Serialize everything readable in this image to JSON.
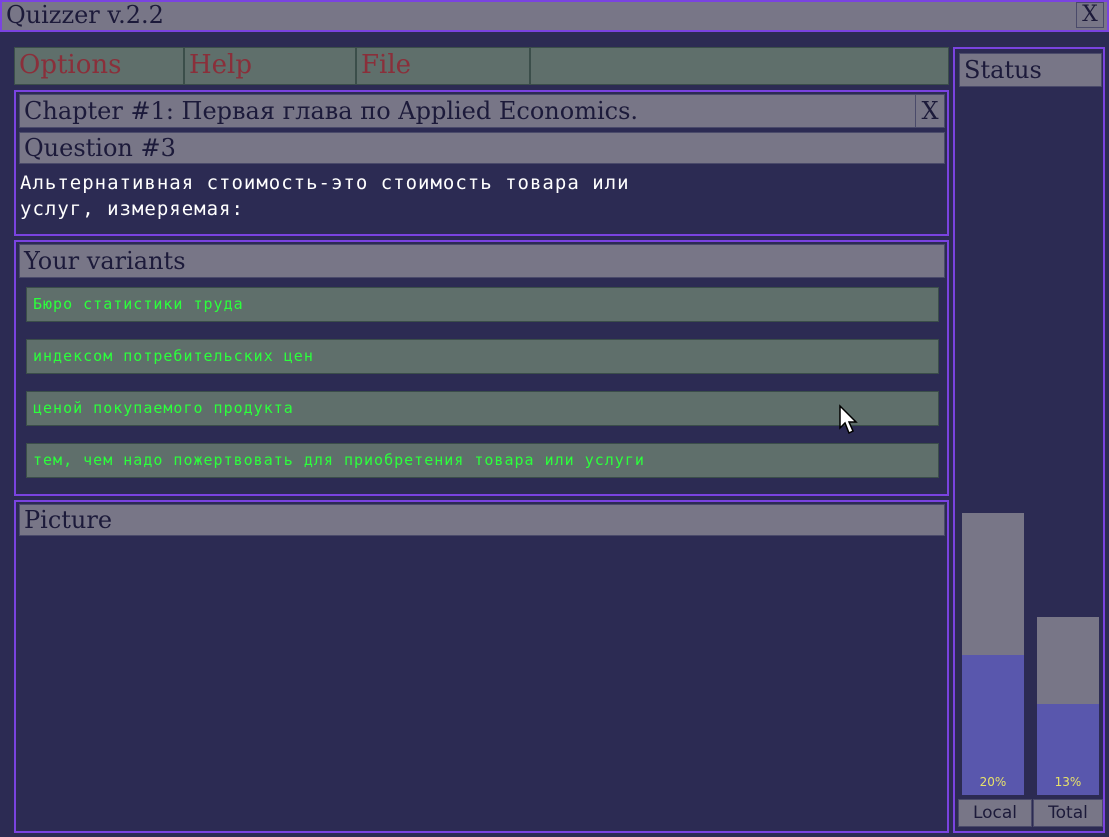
{
  "window": {
    "title": "Quizzer v.2.2",
    "close_label": "X"
  },
  "menu": {
    "items": [
      "Options",
      "Help",
      "File"
    ]
  },
  "chapter": {
    "title": "Chapter #1: Первая глава по Applied Economics.",
    "close_label": "X"
  },
  "question": {
    "header": "Question #3",
    "line1": "Альтернативная стоимость-это стоимость товара или",
    "line2": "услуг, измеряемая:"
  },
  "variants": {
    "header": "Your variants",
    "items": [
      "Бюро статистики труда",
      "индексом потребительских цен",
      "ценой покупаемого продукта",
      "тем, чем надо пожертвовать для приобретения товара или услуги"
    ]
  },
  "picture": {
    "header": "Picture"
  },
  "status": {
    "title": "Status",
    "local": {
      "label": "Local",
      "percent_text": "20%",
      "fraction": 0.2
    },
    "total": {
      "label": "Total",
      "percent_text": "13%",
      "fraction": 0.13
    }
  },
  "colors": {
    "frame_border": "#7a43e0",
    "background": "#2c2b53",
    "bar": "#787687",
    "variant_bg": "#5f6f6b",
    "variant_text": "#2cff3c",
    "menu_text": "#8a2f3a",
    "progress_fill": "#5957ad",
    "percent_text": "#e8e26a"
  }
}
